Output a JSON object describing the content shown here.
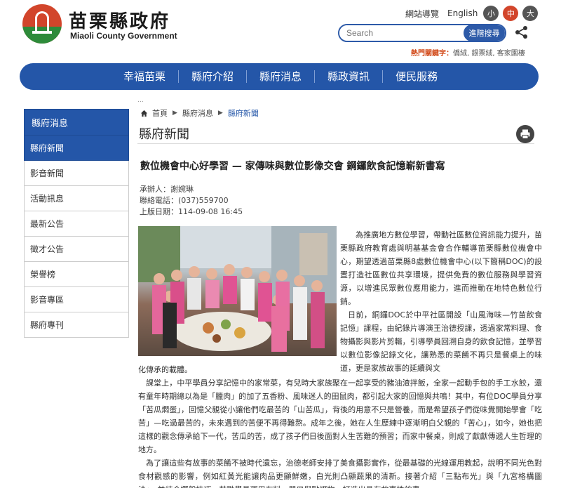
{
  "header": {
    "title": "苗栗縣政府",
    "subtitle": "Miaoli County Government",
    "top_links": [
      "網站導覽",
      "English"
    ],
    "font_sizes": [
      "小",
      "中",
      "大"
    ],
    "font_size_colors": [
      "#555555",
      "#d2452b",
      "#555555"
    ],
    "search_placeholder": "Search",
    "search_button": "進階搜尋",
    "hotwords_label": "熱門關鍵字：",
    "hotwords": "僑絨, 銀票絨, 客家園樓"
  },
  "nav": {
    "items": [
      "幸福苗栗",
      "縣府介紹",
      "縣府消息",
      "縣政資訊",
      "便民服務"
    ]
  },
  "sidebar": {
    "heading": "縣府消息",
    "items": [
      "縣府新聞",
      "影音新聞",
      "活動訊息",
      "最新公告",
      "徵才公告",
      "榮譽榜",
      "影音專區",
      "縣府專刊"
    ],
    "active_index": 0
  },
  "breadcrumb": {
    "dots": "…",
    "home": "首頁",
    "items": [
      "縣府消息",
      "縣府新聞"
    ]
  },
  "page": {
    "title": "縣府新聞"
  },
  "article": {
    "title": "數位機會中心好學習 — 家傳味與數位影像交會 鋼鑼飲食記憶嶄新書寫",
    "contact": "承辦人：謝婉琳",
    "phone": "聯絡電話：(037)559700",
    "date": "上版日期：114-09-08 16:45",
    "side_paragraphs": [
      "為推廣地方數位學習，帶動社區數位資訊能力提升，苗栗縣政府教育處與明基基金會合作輔導苗栗縣數位機會中心，期望透過苗栗縣8處數位機會中心(以下簡稱DOC)的設置打造社區數位共享環境，提供免費的數位服務與學習資源，以增進民眾數位應用能力，進而推動在地特色數位行銷。",
      "日前，銅鑼DOC於中平社區開設「山風海味—竹苗飲食記憶」課程，由紀錄片導演王治德授課，透過家常料理、食物攝影與影片剪輯，引導學員回溯自身的飲食記憶，並學習以數位影像記錄文化，讓熟悉的菜餚不再只是餐桌上的味道，更是家族故事的延續與文"
    ],
    "full_paragraphs": [
      "化傳承的載體。",
      "課堂上，中平學員分享記憶中的家常菜，有兒時大家族聚在一起享受的豬油渣拌飯，全家一起動手包的手工水餃，還有童年時期總以為是「臘肉」的加了五香粉、風味迷人的田鼠肉，都引起大家的回憶與共鳴！其中，有位DOC學員分享「苦瓜燜蛋」，回憶父親從小讓他們吃最苦的「山苦瓜」，背後的用意不只是營養，而是希望孩子們從味覺開始學會「吃苦」—吃過最苦的，未來遇到的苦便不再得難熬。成年之後，她在人生歷練中逐漸明白父親的「苦心」，如今，她也把這樣的觀念傳承給下一代，苦瓜的苦，成了孩子們日後面對人生苦難的預習；而家中餐桌，則成了獻獻傳遞人生哲理的地方。",
      "為了讓這些有故事的菜餚不被時代遺忘，治德老師安排了美食攝影實作，從最基礎的光線運用教起，說明不同光色對食材觀感的影響，例如紅黃光能讓肉品更顯鮮嫩，白光則凸顯蔬果的清新。接著介紹「三點布光」與「九宮格構圖法」，並結合擺盤技巧，鼓勵學員運用布料、器皿與點綴物，打造出具有故事性的畫"
    ]
  }
}
